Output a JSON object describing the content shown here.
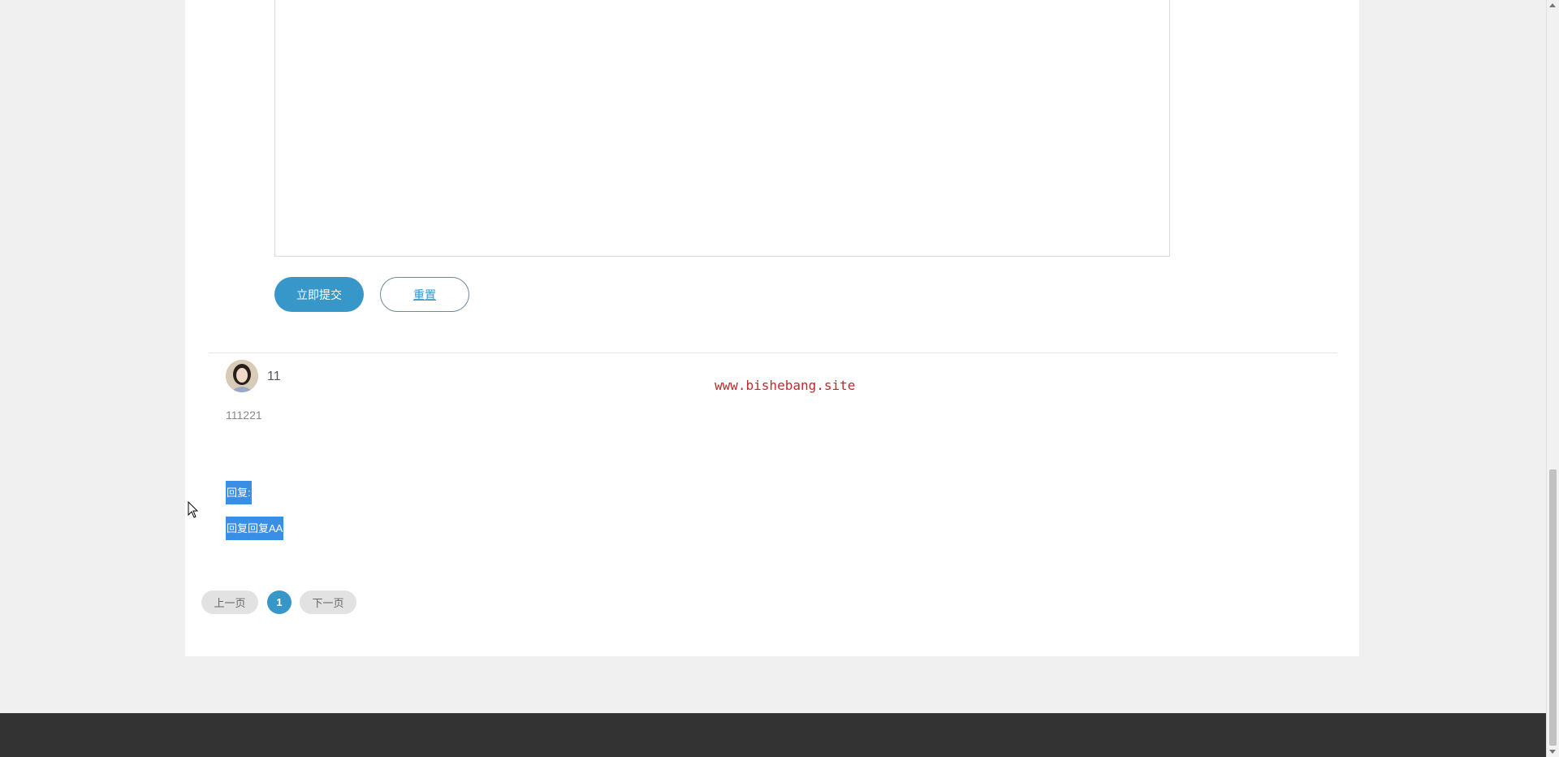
{
  "form": {
    "textarea_value": "",
    "submit_label": "立即提交",
    "reset_label": "重置"
  },
  "comment": {
    "username": "11",
    "content": "111221",
    "reply_label": "回复:",
    "reply_content": "回复回复AA"
  },
  "watermark": "www.bishebang.site",
  "pagination": {
    "prev_label": "上一页",
    "current_page": "1",
    "next_label": "下一页"
  },
  "colors": {
    "accent": "#3797c9",
    "selection": "#3a8ee6",
    "watermark": "#c0282d",
    "footer": "#333333"
  },
  "icons": {
    "avatar": "user-avatar-photo",
    "cursor": "mouse-pointer-icon"
  }
}
